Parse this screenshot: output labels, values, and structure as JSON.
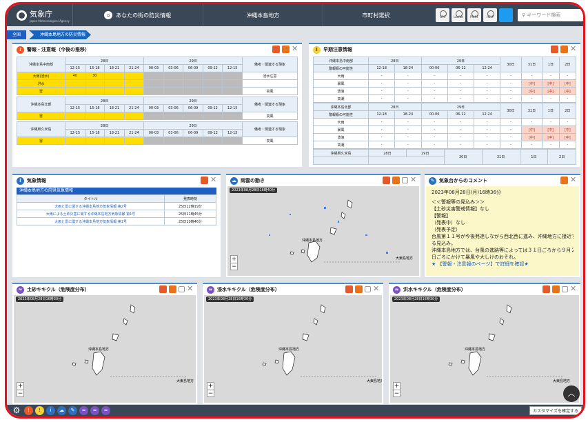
{
  "header": {
    "logo_title": "気象庁",
    "logo_sub": "Japan Meteorological Agency",
    "nav_local": "あなたの街の防災情報",
    "nav_region": "沖縄本島地方",
    "nav_city": "市町村選択",
    "tools": [
      "GPS",
      "Leaflet",
      "PRINT",
      "HELP",
      "Twitter"
    ],
    "search_placeholder": "キーワード検索"
  },
  "breadcrumb": {
    "home": "全国",
    "current": "沖縄本島地方の防災情報"
  },
  "warnings": {
    "title": "警報・注意報（今後の推移）",
    "sections": [
      {
        "area": "沖縄本島中南部",
        "days": [
          "28日",
          "29日"
        ],
        "times": [
          "12-15",
          "15-18",
          "18-21",
          "21-24",
          "00-03",
          "03-06",
          "06-09",
          "09-12",
          "12-15"
        ],
        "remark_header": "備考・関連する現象",
        "rows": [
          {
            "label": "大雨(浸水)",
            "cells": [
              "40",
              "30",
              "",
              "",
              "",
              "",
              "",
              "",
              ""
            ],
            "remark": "浸水注意"
          },
          {
            "label": "洪水",
            "cells": [
              "",
              "",
              "",
              "",
              "",
              "",
              "",
              "",
              ""
            ],
            "remark": ""
          },
          {
            "label": "雷",
            "cells": [
              "",
              "",
              "",
              "",
              "",
              "",
              "",
              "",
              ""
            ],
            "remark": "突風"
          }
        ]
      },
      {
        "area": "沖縄本島北部",
        "days": [
          "28日",
          "29日"
        ],
        "times": [
          "12-15",
          "15-18",
          "18-21",
          "21-24",
          "00-03",
          "03-06",
          "06-09",
          "09-12",
          "12-15"
        ],
        "remark_header": "備考・関連する現象",
        "rows": [
          {
            "label": "雷",
            "cells": [
              "",
              "",
              "",
              "",
              "",
              "",
              "",
              "",
              ""
            ],
            "remark": "突風"
          }
        ]
      },
      {
        "area": "沖縄県久米島",
        "days": [
          "28日",
          "29日"
        ],
        "times": [
          "12-15",
          "15-18",
          "18-21",
          "21-24",
          "00-03",
          "03-06",
          "06-09",
          "09-12",
          "12-15"
        ],
        "remark_header": "備考・関連する現象",
        "rows": [
          {
            "label": "雷",
            "cells": [
              "",
              "",
              "",
              "",
              "",
              "",
              "",
              "",
              ""
            ],
            "remark": "突風"
          }
        ]
      }
    ]
  },
  "early": {
    "title": "早期注意情報",
    "sections": [
      {
        "area": "沖縄本島中南部",
        "sub": "警報級の可能性",
        "days": [
          "28日",
          "29日"
        ],
        "times": [
          "12-18",
          "18-24",
          "00-06",
          "06-12",
          "12-24"
        ],
        "later": [
          "30日",
          "31日",
          "1日",
          "2日"
        ],
        "rows": [
          {
            "label": "大雨",
            "cells": [
              "-",
              "-",
              "-",
              "-",
              "-"
            ],
            "later": [
              "-",
              "-",
              "-",
              "-"
            ]
          },
          {
            "label": "暴風",
            "cells": [
              "-",
              "-",
              "-",
              "-",
              "-"
            ],
            "later": [
              "-",
              "[中]",
              "[中]",
              "[中]"
            ]
          },
          {
            "label": "波浪",
            "cells": [
              "-",
              "-",
              "-",
              "-",
              "-"
            ],
            "later": [
              "-",
              "[中]",
              "[中]",
              "[中]"
            ]
          },
          {
            "label": "高潮",
            "cells": [
              "-",
              "-",
              "-",
              "-",
              "-"
            ],
            "later": [
              "-",
              "-",
              "-",
              "-"
            ]
          }
        ]
      },
      {
        "area": "沖縄本島北部",
        "sub": "警報級の可能性",
        "days": [
          "28日",
          "29日"
        ],
        "times": [
          "12-18",
          "18-24",
          "00-06",
          "06-12",
          "12-24"
        ],
        "later": [
          "30日",
          "31日",
          "1日",
          "2日"
        ],
        "rows": [
          {
            "label": "大雨",
            "cells": [
              "-",
              "-",
              "-",
              "-",
              "-"
            ],
            "later": [
              "-",
              "-",
              "-",
              "-"
            ]
          },
          {
            "label": "暴風",
            "cells": [
              "-",
              "-",
              "-",
              "-",
              "-"
            ],
            "later": [
              "-",
              "[中]",
              "[中]",
              "[中]"
            ]
          },
          {
            "label": "波浪",
            "cells": [
              "-",
              "-",
              "-",
              "-",
              "-"
            ],
            "later": [
              "-",
              "[中]",
              "[中]",
              "[中]"
            ]
          },
          {
            "label": "高潮",
            "cells": [
              "-",
              "-",
              "-",
              "-",
              "-"
            ],
            "later": [
              "-",
              "-",
              "-",
              "-"
            ]
          }
        ]
      },
      {
        "area": "沖縄県久米島",
        "days": [
          "28日",
          "29日"
        ],
        "later": [
          "30日",
          "31日",
          "1日",
          "2日"
        ]
      }
    ]
  },
  "weather_info": {
    "title": "気象情報",
    "list_title": "沖縄本島地方の府県気象情報",
    "col_title": "タイトル",
    "col_time": "発表時刻",
    "items": [
      {
        "title": "大雨と雷に関する沖縄本島地方気象情報 第2号",
        "time": "25日12時19分"
      },
      {
        "title": "大雨による土砂災害に関する沖縄本島地方気象情報 第1号",
        "time": "25日11時45分"
      },
      {
        "title": "大雨と雷に関する沖縄本島地方気象情報 第1号",
        "time": "25日10時46分"
      }
    ]
  },
  "rain": {
    "title": "雨雲の動き",
    "timestamp": "2023年08月28日16時40分"
  },
  "comment": {
    "title": "気象台からのコメント",
    "date": "2023年08月28日(月)16時36分",
    "lines": [
      "＜＜警報等の見込み＞＞",
      "【土砂災害警戒情報】なし",
      "【警報】",
      "（発表中）なし",
      "（発表予定）",
      "台風第１１号が今後発達しながら西北西に進み、沖縄地方に接近す",
      "る見込み。",
      "沖縄本島地方では、台風の進路等によっては３１日ごろから９月２",
      "日ごろにかけて暴風や大しけのおそれ。",
      "★ 【警報・注意報のページ】で詳細を確認★"
    ]
  },
  "maps": [
    {
      "title": "土砂キキクル（危険度分布）",
      "timestamp": "2023年08月28日16時30分"
    },
    {
      "title": "浸水キキクル（危険度分布）",
      "timestamp": "2023年08月28日16時30分"
    },
    {
      "title": "洪水キキクル（危険度分布）",
      "timestamp": "2023年08月28日16時30分"
    }
  ],
  "map_labels": {
    "north": "沖縄本島地方",
    "east": "大東島地方"
  },
  "zoom": {
    "in": "+",
    "out": "−"
  },
  "footer": {
    "customize": "カスタマイズを確定する",
    "up": "︿"
  }
}
